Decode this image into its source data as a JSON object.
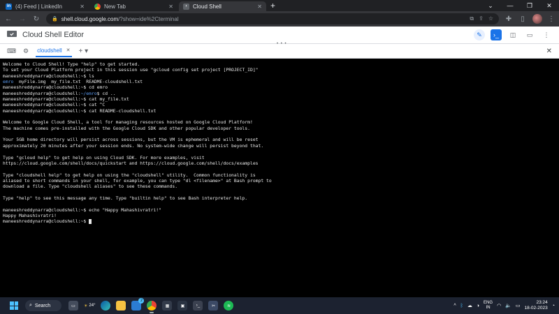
{
  "browser": {
    "tabs": [
      {
        "title": "(4) Feed | LinkedIn",
        "favicon": "linkedin-icon",
        "color": "#0a66c2",
        "active": false
      },
      {
        "title": "New Tab",
        "favicon": "chrome-icon",
        "color": "#4285f4",
        "active": false
      },
      {
        "title": "Cloud Shell",
        "favicon": "cloud-shell-icon",
        "color": "#5f6368",
        "active": true
      }
    ],
    "address": {
      "host": "shell.cloud.google.com",
      "path": "/?show=ide%2Cterminal"
    }
  },
  "cloudshell": {
    "title": "Cloud Shell Editor",
    "terminal_tab": "cloudshell"
  },
  "terminal": {
    "lines": [
      [
        {
          "t": "Welcome to Cloud Shell! Type \"help\" to get started."
        }
      ],
      [
        {
          "t": "To set your Cloud Platform project in this session use \"gcloud config set project [PROJECT_ID]\""
        }
      ],
      [
        {
          "t": "maneeshreddynarra@cloudshell:~$ ls"
        }
      ],
      [
        {
          "t": "emro",
          "c": "blue"
        },
        {
          "t": "  myFile.img  my_file.txt  README-cloudshell.txt"
        }
      ],
      [
        {
          "t": "maneeshreddynarra@cloudshell:~$ cd emro"
        }
      ],
      [
        {
          "t": "maneeshreddynarra@cloudshell:"
        },
        {
          "t": "~/emro",
          "c": "blue"
        },
        {
          "t": "$ cd .."
        }
      ],
      [
        {
          "t": "maneeshreddynarra@cloudshell:~$ cat my_file.txt"
        }
      ],
      [
        {
          "t": "maneeshreddynarra@cloudshell:~$ cat ^C"
        }
      ],
      [
        {
          "t": "maneeshreddynarra@cloudshell:~$ cat README-cloudshell.txt"
        }
      ],
      [
        {
          "t": ""
        }
      ],
      [
        {
          "t": "Welcome to Google Cloud Shell, a tool for managing resources hosted on Google Cloud Platform!"
        }
      ],
      [
        {
          "t": "The machine comes pre-installed with the Google Cloud SDK and other popular developer tools."
        }
      ],
      [
        {
          "t": ""
        }
      ],
      [
        {
          "t": "Your 5GB home directory will persist across sessions, but the VM is ephemeral and will be reset"
        }
      ],
      [
        {
          "t": "approximately 20 minutes after your session ends. No system-wide change will persist beyond that."
        }
      ],
      [
        {
          "t": ""
        }
      ],
      [
        {
          "t": "Type \"gcloud help\" to get help on using Cloud SDK. For more examples, visit"
        }
      ],
      [
        {
          "t": "https://cloud.google.com/shell/docs/quickstart and https://cloud.google.com/shell/docs/examples"
        }
      ],
      [
        {
          "t": ""
        }
      ],
      [
        {
          "t": "Type \"cloudshell help\" to get help on using the \"cloudshell\" utility.  Common functionality is"
        }
      ],
      [
        {
          "t": "aliased to short commands in your shell, for example, you can type \"dl <filename>\" at Bash prompt to"
        }
      ],
      [
        {
          "t": "download a file. Type \"cloudshell aliases\" to see these commands."
        }
      ],
      [
        {
          "t": ""
        }
      ],
      [
        {
          "t": "Type \"help\" to see this message any time. Type \"builtin help\" to see Bash interpreter help."
        }
      ],
      [
        {
          "t": ""
        }
      ],
      [
        {
          "t": "maneeshreddynarra@cloudshell:~$ echo \"Happy Mahashivratri!\""
        }
      ],
      [
        {
          "t": "Happy Mahashivratri!"
        }
      ],
      [
        {
          "t": "maneeshreddynarra@cloudshell:~$ ",
          "cursor": true
        }
      ]
    ]
  },
  "taskbar": {
    "search_label": "Search",
    "weather": "24°",
    "badge": "2",
    "lang_top": "ENG",
    "lang_bottom": "IN",
    "time": "23:24",
    "date": "18-02-2023"
  },
  "colors": {
    "accent": "#1a73e8",
    "terminal_bg": "#000000",
    "dir_blue": "#5b9bf0"
  }
}
